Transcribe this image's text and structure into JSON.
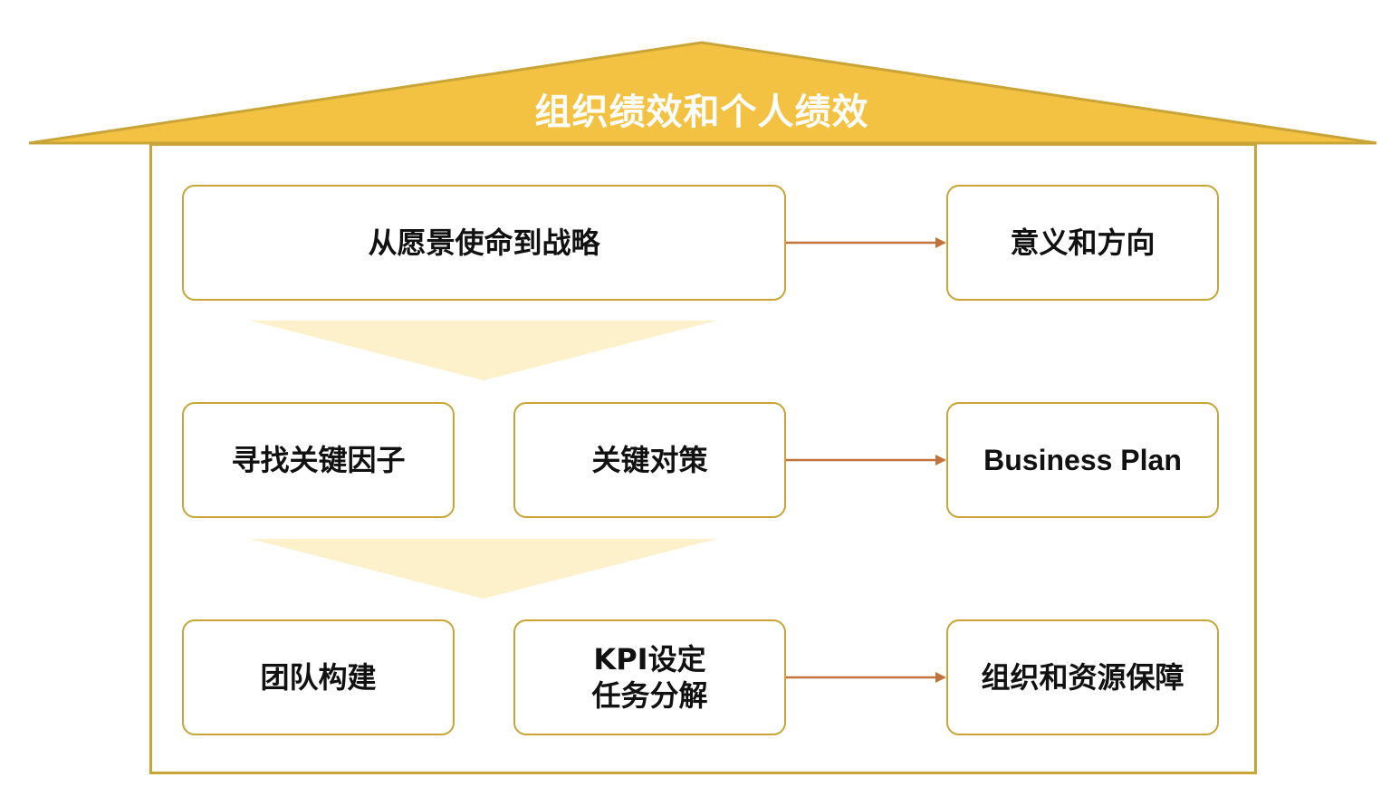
{
  "title": "组织绩效和个人绩效",
  "colors": {
    "roof": "#f4c242",
    "border": "#c9a437",
    "arrow": "#c0743a",
    "chevron": "#fdf1cc",
    "text": "#111111",
    "title_text": "#ffffff"
  },
  "rows": [
    {
      "left": [
        "从愿景使命到战略"
      ],
      "outcome": "意义和方向"
    },
    {
      "left": [
        "寻找关键因子",
        "关键对策"
      ],
      "outcome": "Business Plan"
    },
    {
      "left": [
        "团队构建",
        "KPI设定",
        "任务分解"
      ],
      "outcome": "组织和资源保障"
    }
  ]
}
